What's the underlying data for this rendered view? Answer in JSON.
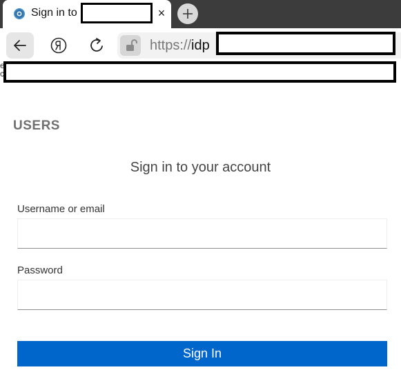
{
  "browser": {
    "tab_title": "Sign in to",
    "tab_close": "×",
    "new_tab": "+",
    "url_scheme": "https://",
    "url_host": "idp",
    "bookmark_left_chars": "e\nc",
    "icons": [
      "favicon-icon",
      "close-icon",
      "plus-icon",
      "back-arrow-icon",
      "yandex-icon",
      "reload-icon",
      "unlocked-padlock-icon"
    ]
  },
  "page": {
    "realm": "USERS",
    "heading": "Sign in to your account",
    "username_label": "Username or email",
    "username_value": "",
    "password_label": "Password",
    "password_value": "",
    "submit_label": "Sign In"
  },
  "colors": {
    "primary": "#0066cc",
    "tabstrip": "#3c3c3c",
    "realm_text": "#6f6f6f"
  }
}
